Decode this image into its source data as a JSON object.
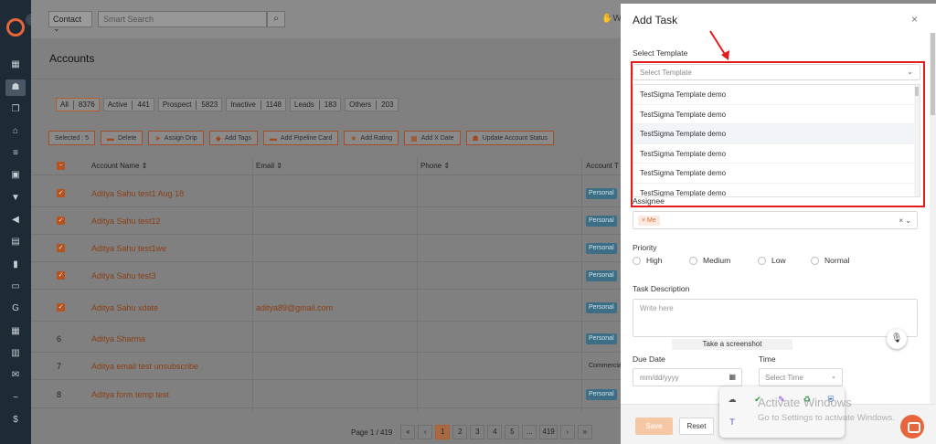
{
  "nav": {
    "icons": [
      "dashboard-icon",
      "contacts-icon",
      "documents-icon",
      "bank-icon",
      "list-icon",
      "forms-icon",
      "funnel-icon",
      "megaphone-icon",
      "notes-icon",
      "reports-icon",
      "folder-icon",
      "google-icon",
      "calendar-icon",
      "sheet-icon",
      "mail-icon",
      "signature-icon",
      "dollar-icon"
    ]
  },
  "topbar": {
    "contact_dropdown": "Contact",
    "search_placeholder": "Smart Search",
    "hand_label": "W"
  },
  "page": {
    "title": "Accounts"
  },
  "filters": [
    {
      "label": "All",
      "count": "8376"
    },
    {
      "label": "Active",
      "count": "441"
    },
    {
      "label": "Prospect",
      "count": "5823"
    },
    {
      "label": "Inactive",
      "count": "1148"
    },
    {
      "label": "Leads",
      "count": "183"
    },
    {
      "label": "Others",
      "count": "203"
    }
  ],
  "actions": {
    "selected": "Selected : 5",
    "buttons": [
      {
        "label": "Delete",
        "icon": "trash-icon"
      },
      {
        "label": "Assign Drip",
        "icon": "send-icon"
      },
      {
        "label": "Add Tags",
        "icon": "tag-icon"
      },
      {
        "label": "Add Pipeline Card",
        "icon": "card-icon"
      },
      {
        "label": "Add Rating",
        "icon": "star-icon"
      },
      {
        "label": "Add X Date",
        "icon": "calendar-icon"
      },
      {
        "label": "Update Account Status",
        "icon": "users-icon"
      }
    ]
  },
  "table": {
    "headers": {
      "name": "Account Name ⇕",
      "email": "Email ⇕",
      "phone": "Phone ⇕",
      "type": "Account T"
    },
    "rows": [
      {
        "marker": "✓",
        "name": "Aditya Sahu test1 Aug 18",
        "email": "",
        "type": "Personal"
      },
      {
        "marker": "✓",
        "name": "Aditya Sahu test12",
        "email": "",
        "type": "Personal"
      },
      {
        "marker": "✓",
        "name": "Aditya Sahu test1we",
        "email": "",
        "type": "Personal"
      },
      {
        "marker": "✓",
        "name": "Aditya Sahu test3",
        "email": "",
        "type": "Personal"
      },
      {
        "marker": "✓",
        "name": "Aditya Sahu xdate",
        "email": "aditya89@gmail.com",
        "type": "Personal"
      },
      {
        "marker": "6",
        "name": "Aditya Sharma",
        "email": "",
        "type": "Personal"
      },
      {
        "marker": "7",
        "name": "Aditya email test unsubscribe",
        "email": "",
        "type": "Commercial"
      },
      {
        "marker": "8",
        "name": "Aditya form temp test",
        "email": "",
        "type": "Personal"
      }
    ]
  },
  "pager": {
    "label": "Page 1 / 419",
    "items": [
      "«",
      "‹",
      "1",
      "2",
      "3",
      "4",
      "5",
      "...",
      "419",
      "›",
      "»"
    ]
  },
  "panel": {
    "title": "Add Task",
    "close": "×",
    "template_label": "Select Template",
    "template_placeholder": "Select Template",
    "templates": [
      "TestSigma Template demo",
      "TestSigma Template demo",
      "TestSigma Template demo",
      "TestSigma Template demo",
      "TestSigma Template demo",
      "TestSigma Template demo"
    ],
    "assignee_label": "Assignee",
    "assignee_tag": "× Me",
    "assignee_controls": "×  ⌄",
    "priority_label": "Priority",
    "priorities": [
      "High",
      "Medium",
      "Low",
      "Normal"
    ],
    "description_label": "Task Description",
    "description_placeholder": "Write here",
    "screenshot_tip": "Take a screenshot",
    "due_date_label": "Due Date",
    "due_date_placeholder": "mm/dd/yyyy",
    "time_label": "Time",
    "time_placeholder": "Select Time",
    "save": "Save",
    "reset": "Reset"
  },
  "watermark": {
    "line1": "Activate Windows",
    "line2": "Go to Settings to activate Windows."
  },
  "colors": {
    "accent": "#e8643a",
    "nav_bg": "#1e2a35",
    "highlight_red": "#e31b1b"
  }
}
